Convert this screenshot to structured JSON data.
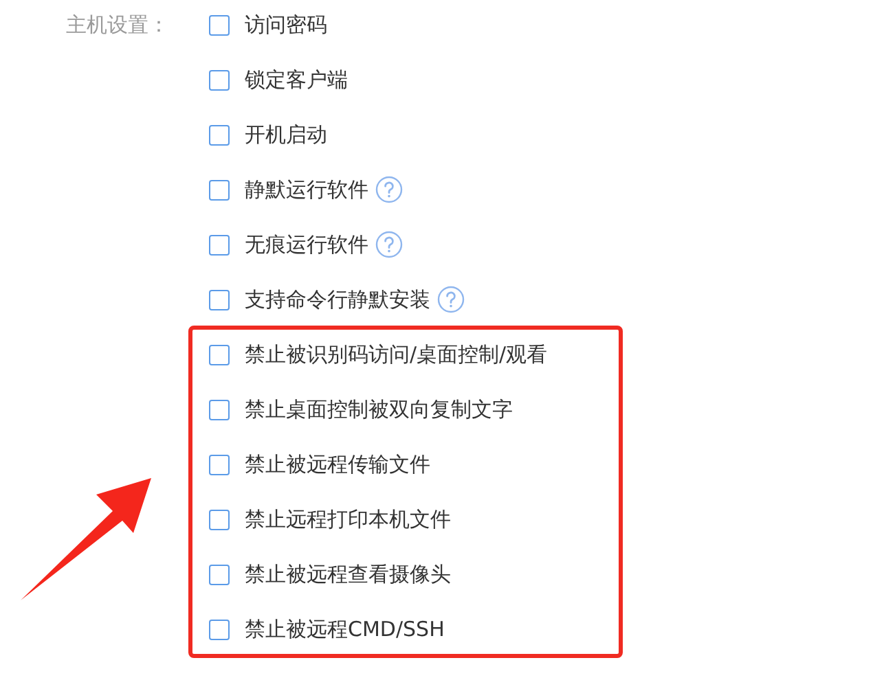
{
  "host_settings": {
    "label": "主机设置：",
    "groups": [
      {
        "highlighted": false,
        "options": [
          {
            "label": "访问密码",
            "checked": false,
            "help": false
          },
          {
            "label": "锁定客户端",
            "checked": false,
            "help": false
          },
          {
            "label": "开机启动",
            "checked": false,
            "help": false
          },
          {
            "label": "静默运行软件",
            "checked": false,
            "help": true
          },
          {
            "label": "无痕运行软件",
            "checked": false,
            "help": true
          },
          {
            "label": "支持命令行静默安装",
            "checked": false,
            "help": true
          }
        ]
      },
      {
        "highlighted": true,
        "options": [
          {
            "label": "禁止被识别码访问/桌面控制/观看",
            "checked": false,
            "help": false
          },
          {
            "label": "禁止桌面控制被双向复制文字",
            "checked": false,
            "help": false
          },
          {
            "label": "禁止被远程传输文件",
            "checked": false,
            "help": false
          },
          {
            "label": "禁止远程打印本机文件",
            "checked": false,
            "help": false
          },
          {
            "label": "禁止被远程查看摄像头",
            "checked": false,
            "help": false
          },
          {
            "label": "禁止被远程CMD/SSH",
            "checked": false,
            "help": false
          }
        ]
      }
    ]
  },
  "pointer_arrow": true
}
